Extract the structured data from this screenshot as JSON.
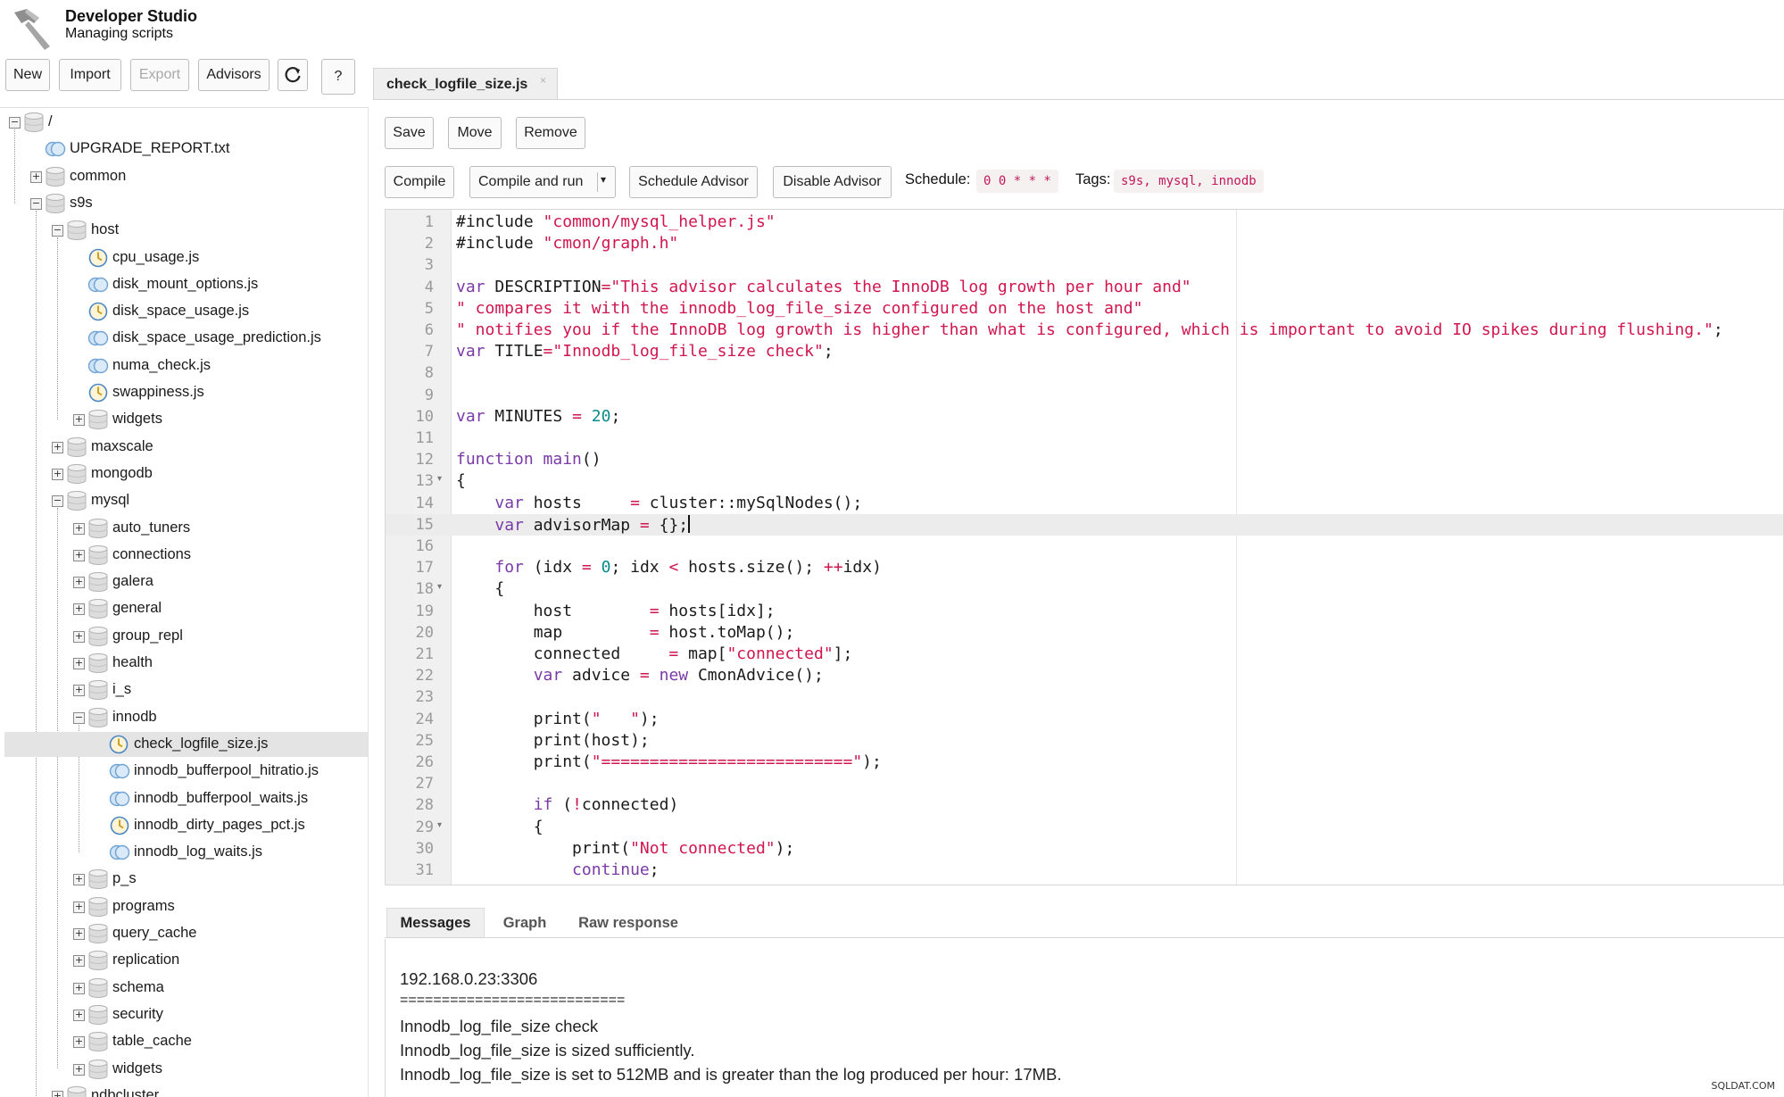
{
  "app": {
    "title": "Developer Studio",
    "subtitle": "Managing scripts"
  },
  "toolbar": {
    "new": "New",
    "import": "Import",
    "export": "Export",
    "advisors": "Advisors",
    "refresh_icon": "refresh-icon",
    "help": "?"
  },
  "tree": [
    {
      "label": "/",
      "level": 0,
      "type": "folder",
      "state": "open"
    },
    {
      "label": "UPGRADE_REPORT.txt",
      "level": 1,
      "type": "file",
      "state": "none"
    },
    {
      "label": "common",
      "level": 1,
      "type": "folder",
      "state": "closed"
    },
    {
      "label": "s9s",
      "level": 1,
      "type": "folder",
      "state": "open"
    },
    {
      "label": "host",
      "level": 2,
      "type": "folder",
      "state": "open"
    },
    {
      "label": "cpu_usage.js",
      "level": 3,
      "type": "advisor",
      "state": "none"
    },
    {
      "label": "disk_mount_options.js",
      "level": 3,
      "type": "file",
      "state": "none"
    },
    {
      "label": "disk_space_usage.js",
      "level": 3,
      "type": "advisor",
      "state": "none"
    },
    {
      "label": "disk_space_usage_prediction.js",
      "level": 3,
      "type": "file",
      "state": "none"
    },
    {
      "label": "numa_check.js",
      "level": 3,
      "type": "file",
      "state": "none"
    },
    {
      "label": "swappiness.js",
      "level": 3,
      "type": "advisor",
      "state": "none"
    },
    {
      "label": "widgets",
      "level": 3,
      "type": "folder",
      "state": "closed"
    },
    {
      "label": "maxscale",
      "level": 2,
      "type": "folder",
      "state": "closed"
    },
    {
      "label": "mongodb",
      "level": 2,
      "type": "folder",
      "state": "closed"
    },
    {
      "label": "mysql",
      "level": 2,
      "type": "folder",
      "state": "open"
    },
    {
      "label": "auto_tuners",
      "level": 3,
      "type": "folder",
      "state": "closed"
    },
    {
      "label": "connections",
      "level": 3,
      "type": "folder",
      "state": "closed"
    },
    {
      "label": "galera",
      "level": 3,
      "type": "folder",
      "state": "closed"
    },
    {
      "label": "general",
      "level": 3,
      "type": "folder",
      "state": "closed"
    },
    {
      "label": "group_repl",
      "level": 3,
      "type": "folder",
      "state": "closed"
    },
    {
      "label": "health",
      "level": 3,
      "type": "folder",
      "state": "closed"
    },
    {
      "label": "i_s",
      "level": 3,
      "type": "folder",
      "state": "closed"
    },
    {
      "label": "innodb",
      "level": 3,
      "type": "folder",
      "state": "open"
    },
    {
      "label": "check_logfile_size.js",
      "level": 4,
      "type": "advisor",
      "state": "none",
      "selected": true
    },
    {
      "label": "innodb_bufferpool_hitratio.js",
      "level": 4,
      "type": "file",
      "state": "none"
    },
    {
      "label": "innodb_bufferpool_waits.js",
      "level": 4,
      "type": "file",
      "state": "none"
    },
    {
      "label": "innodb_dirty_pages_pct.js",
      "level": 4,
      "type": "advisor",
      "state": "none"
    },
    {
      "label": "innodb_log_waits.js",
      "level": 4,
      "type": "file",
      "state": "none"
    },
    {
      "label": "p_s",
      "level": 3,
      "type": "folder",
      "state": "closed"
    },
    {
      "label": "programs",
      "level": 3,
      "type": "folder",
      "state": "closed"
    },
    {
      "label": "query_cache",
      "level": 3,
      "type": "folder",
      "state": "closed"
    },
    {
      "label": "replication",
      "level": 3,
      "type": "folder",
      "state": "closed"
    },
    {
      "label": "schema",
      "level": 3,
      "type": "folder",
      "state": "closed"
    },
    {
      "label": "security",
      "level": 3,
      "type": "folder",
      "state": "closed"
    },
    {
      "label": "table_cache",
      "level": 3,
      "type": "folder",
      "state": "closed"
    },
    {
      "label": "widgets",
      "level": 3,
      "type": "folder",
      "state": "closed"
    },
    {
      "label": "ndbcluster",
      "level": 2,
      "type": "folder",
      "state": "closed"
    }
  ],
  "editor_tab": {
    "label": "check_logfile_size.js",
    "close": "×"
  },
  "file_actions": {
    "save": "Save",
    "move": "Move",
    "remove": "Remove"
  },
  "advisor_bar": {
    "compile": "Compile",
    "compile_run": "Compile and run",
    "dropdown": "▾",
    "schedule_advisor": "Schedule Advisor",
    "disable_advisor": "Disable Advisor",
    "schedule_label": "Schedule:",
    "schedule_value": "0 0 * * *",
    "tags_label": "Tags:",
    "tags_value": "s9s, mysql, innodb"
  },
  "code": {
    "active_line": 15,
    "fold_lines": [
      13,
      18,
      29
    ],
    "lines": [
      [
        [
          "p",
          "#include "
        ],
        [
          "s",
          "\"common/mysql_helper.js\""
        ]
      ],
      [
        [
          "p",
          "#include "
        ],
        [
          "s",
          "\"cmon/graph.h\""
        ]
      ],
      [],
      [
        [
          "k",
          "var"
        ],
        [
          "p",
          " DESCRIPTION"
        ],
        [
          "o",
          "="
        ],
        [
          "s",
          "\"This advisor calculates the InnoDB log growth per hour and\""
        ]
      ],
      [
        [
          "s",
          "\" compares it with the innodb_log_file_size configured on the host and\""
        ]
      ],
      [
        [
          "s",
          "\" notifies you if the InnoDB log growth is higher than what is configured, which is important to avoid IO spikes during flushing.\""
        ],
        [
          "p",
          ";"
        ]
      ],
      [
        [
          "k",
          "var"
        ],
        [
          "p",
          " TITLE"
        ],
        [
          "o",
          "="
        ],
        [
          "s",
          "\"Innodb_log_file_size check\""
        ],
        [
          "p",
          ";"
        ]
      ],
      [],
      [],
      [
        [
          "k",
          "var"
        ],
        [
          "p",
          " MINUTES "
        ],
        [
          "o",
          "="
        ],
        [
          "p",
          " "
        ],
        [
          "n",
          "20"
        ],
        [
          "p",
          ";"
        ]
      ],
      [],
      [
        [
          "k",
          "function"
        ],
        [
          "p",
          " "
        ],
        [
          "k",
          "main"
        ],
        [
          "p",
          "()"
        ]
      ],
      [
        [
          "p",
          "{"
        ]
      ],
      [
        [
          "p",
          "    "
        ],
        [
          "k",
          "var"
        ],
        [
          "p",
          " hosts     "
        ],
        [
          "o",
          "="
        ],
        [
          "p",
          " cluster::mySqlNodes();"
        ]
      ],
      [
        [
          "p",
          "    "
        ],
        [
          "k",
          "var"
        ],
        [
          "p",
          " advisorMap "
        ],
        [
          "o",
          "="
        ],
        [
          "p",
          " {};"
        ]
      ],
      [],
      [
        [
          "p",
          "    "
        ],
        [
          "k",
          "for"
        ],
        [
          "p",
          " (idx "
        ],
        [
          "o",
          "="
        ],
        [
          "p",
          " "
        ],
        [
          "n",
          "0"
        ],
        [
          "p",
          "; idx "
        ],
        [
          "o",
          "<"
        ],
        [
          "p",
          " hosts.size(); "
        ],
        [
          "o",
          "++"
        ],
        [
          "p",
          "idx)"
        ]
      ],
      [
        [
          "p",
          "    {"
        ]
      ],
      [
        [
          "p",
          "        host        "
        ],
        [
          "o",
          "="
        ],
        [
          "p",
          " hosts[idx];"
        ]
      ],
      [
        [
          "p",
          "        map         "
        ],
        [
          "o",
          "="
        ],
        [
          "p",
          " host.toMap();"
        ]
      ],
      [
        [
          "p",
          "        connected     "
        ],
        [
          "o",
          "="
        ],
        [
          "p",
          " map["
        ],
        [
          "s",
          "\"connected\""
        ],
        [
          "p",
          "];"
        ]
      ],
      [
        [
          "p",
          "        "
        ],
        [
          "k",
          "var"
        ],
        [
          "p",
          " advice "
        ],
        [
          "o",
          "="
        ],
        [
          "p",
          " "
        ],
        [
          "k",
          "new"
        ],
        [
          "p",
          " CmonAdvice();"
        ]
      ],
      [],
      [
        [
          "p",
          "        print("
        ],
        [
          "s",
          "\"   \""
        ],
        [
          "p",
          ");"
        ]
      ],
      [
        [
          "p",
          "        print(host);"
        ]
      ],
      [
        [
          "p",
          "        print("
        ],
        [
          "s",
          "\"==========================\""
        ],
        [
          "p",
          ");"
        ]
      ],
      [],
      [
        [
          "p",
          "        "
        ],
        [
          "k",
          "if"
        ],
        [
          "p",
          " ("
        ],
        [
          "o",
          "!"
        ],
        [
          "p",
          "connected)"
        ]
      ],
      [
        [
          "p",
          "        {"
        ]
      ],
      [
        [
          "p",
          "            print("
        ],
        [
          "s",
          "\"Not connected\""
        ],
        [
          "p",
          ");"
        ]
      ],
      [
        [
          "p",
          "            "
        ],
        [
          "k",
          "continue"
        ],
        [
          "p",
          ";"
        ]
      ]
    ]
  },
  "panel_tabs": {
    "messages": "Messages",
    "graph": "Graph",
    "raw": "Raw response"
  },
  "messages": [
    "192.168.0.23:3306",
    "===========================",
    "Innodb_log_file_size check",
    "Innodb_log_file_size is sized sufficiently.",
    "Innodb_log_file_size is set to 512MB and is greater than the log produced per hour: 17MB."
  ],
  "watermark": "SQLDAT.COM",
  "colors": {
    "keyword": "#7a3aa8",
    "string": "#d0164e",
    "number": "#098a8a",
    "selected_row": "#e4e4e4"
  }
}
